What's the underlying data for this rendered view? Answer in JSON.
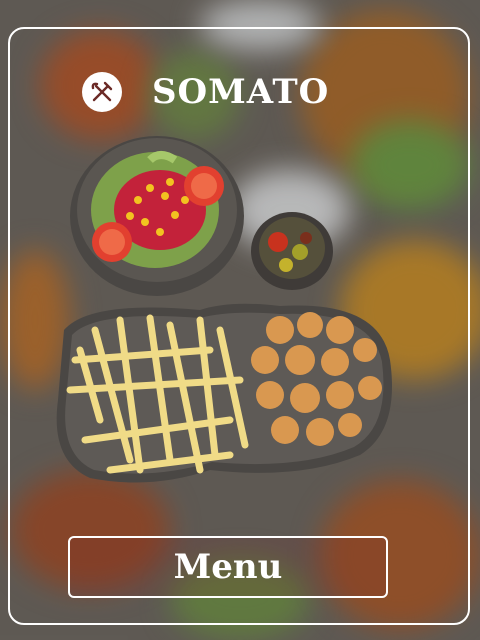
{
  "brand": {
    "name": "SOMATO",
    "logo_icon": "fork-knife-icon"
  },
  "hero": {
    "image": "food-platter-image"
  },
  "actions": {
    "menu_label": "Menu"
  },
  "colors": {
    "frame": "#ffffff",
    "text": "#ffffff",
    "button_tint": "#7a2e2e"
  }
}
